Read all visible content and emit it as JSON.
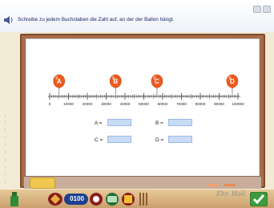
{
  "header": {
    "instruction": "Schreibe zu jedem Buchstaben die Zahl auf, an der der Ballon hängt."
  },
  "numberline": {
    "ticks": [
      "0",
      "10000",
      "20000",
      "30000",
      "40000",
      "50000",
      "60000",
      "70000",
      "80000",
      "90000",
      "100000"
    ],
    "balloons": [
      {
        "letter": "A",
        "value": 5000
      },
      {
        "letter": "B",
        "value": 35000
      },
      {
        "letter": "C",
        "value": 57000
      },
      {
        "letter": "D",
        "value": 97000
      }
    ]
  },
  "answers": [
    {
      "label": "A =",
      "value": ""
    },
    {
      "label": "B =",
      "value": ""
    },
    {
      "label": "C =",
      "value": ""
    },
    {
      "label": "D =",
      "value": ""
    }
  ],
  "footer": {
    "time_display": "0100",
    "signature": "Ehr. Holl."
  },
  "colors": {
    "balloon": "#ee5a1f",
    "frame": "#a76d4a",
    "field": "#c9dcf7",
    "text": "#1e2a6a"
  }
}
